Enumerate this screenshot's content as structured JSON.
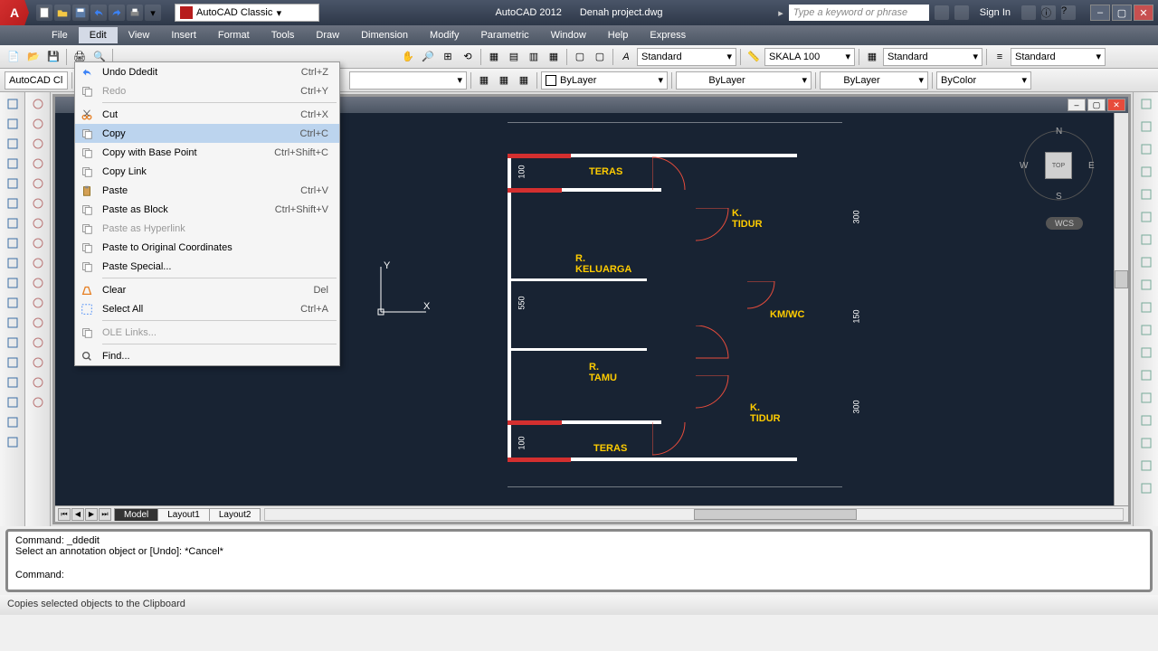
{
  "app": {
    "name": "AutoCAD 2012",
    "file": "Denah project.dwg",
    "workspace": "AutoCAD Classic",
    "logo": "A"
  },
  "titleSearch": {
    "placeholder": "Type a keyword or phrase"
  },
  "signin": "Sign In",
  "menubar": [
    "File",
    "Edit",
    "View",
    "Insert",
    "Format",
    "Tools",
    "Draw",
    "Dimension",
    "Modify",
    "Parametric",
    "Window",
    "Help",
    "Express"
  ],
  "activeMenu": 1,
  "toolbar2": {
    "layer": "AutoCAD Cl"
  },
  "props": {
    "standard1": "Standard",
    "skala": "SKALA 100",
    "standard2": "Standard",
    "standard3": "Standard",
    "bylayer1": "ByLayer",
    "bylayer2": "ByLayer",
    "bylayer3": "ByLayer",
    "bycolor": "ByColor"
  },
  "contextMenu": [
    {
      "icon": "undo",
      "label": "Undo Ddedit",
      "shortcut": "Ctrl+Z"
    },
    {
      "icon": "redo",
      "label": "Redo",
      "shortcut": "Ctrl+Y",
      "disabled": true
    },
    {
      "sep": true
    },
    {
      "icon": "cut",
      "label": "Cut",
      "shortcut": "Ctrl+X"
    },
    {
      "icon": "copy",
      "label": "Copy",
      "shortcut": "Ctrl+C",
      "hovered": true
    },
    {
      "icon": "copybase",
      "label": "Copy with Base Point",
      "shortcut": "Ctrl+Shift+C"
    },
    {
      "icon": "copylink",
      "label": "Copy Link",
      "shortcut": ""
    },
    {
      "icon": "paste",
      "label": "Paste",
      "shortcut": "Ctrl+V"
    },
    {
      "icon": "pasteblock",
      "label": "Paste as Block",
      "shortcut": "Ctrl+Shift+V"
    },
    {
      "icon": "pastehyper",
      "label": "Paste as Hyperlink",
      "shortcut": "",
      "disabled": true
    },
    {
      "icon": "pasteorig",
      "label": "Paste to Original Coordinates",
      "shortcut": ""
    },
    {
      "icon": "pastespecial",
      "label": "Paste Special...",
      "shortcut": ""
    },
    {
      "sep": true
    },
    {
      "icon": "clear",
      "label": "Clear",
      "shortcut": "Del"
    },
    {
      "icon": "selectall",
      "label": "Select All",
      "shortcut": "Ctrl+A"
    },
    {
      "sep": true
    },
    {
      "icon": "ole",
      "label": "OLE Links...",
      "shortcut": "",
      "disabled": true
    },
    {
      "sep": true
    },
    {
      "icon": "find",
      "label": "Find...",
      "shortcut": ""
    }
  ],
  "tabs": {
    "nav": [
      "⏮",
      "◀",
      "▶",
      "⏭"
    ],
    "items": [
      "Model",
      "Layout1",
      "Layout2"
    ],
    "active": 0
  },
  "rooms": {
    "teras1": "TERAS",
    "ktidur1": "K. TIDUR",
    "rkeluarga": "R. KELUARGA",
    "kmwc": "KM/WC",
    "rtamu": "R. TAMU",
    "ktidur2": "K. TIDUR",
    "teras2": "TERAS"
  },
  "dims": {
    "d1": "100",
    "d2": "550",
    "d3": "100",
    "d4": "300",
    "d5": "150",
    "d6": "300"
  },
  "viewcube": {
    "top": "TOP",
    "n": "N",
    "s": "S",
    "e": "E",
    "w": "W",
    "wcs": "WCS"
  },
  "ucs": {
    "x": "X",
    "y": "Y"
  },
  "cmdline": {
    "l1": "Command: _ddedit",
    "l2": "Select an annotation object or [Undo]: *Cancel*",
    "l3": "Command:"
  },
  "statusbar": "Copies selected objects to the Clipboard"
}
